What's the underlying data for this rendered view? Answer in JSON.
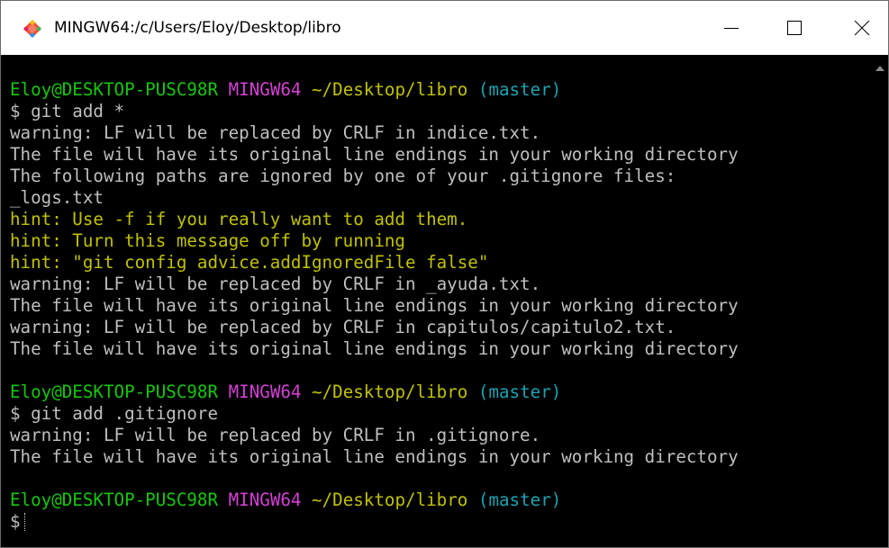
{
  "window": {
    "title": "MINGW64:/c/Users/Eloy/Desktop/libro",
    "icon": "git-icon"
  },
  "colors": {
    "user_host": "#16c60c",
    "mingw": "#d340d3",
    "path": "#c1c100",
    "branch": "#1aa3b3",
    "hint": "#c1c100",
    "text": "#bfbfbf",
    "background": "#000000"
  },
  "terminal": {
    "lines": [
      {
        "type": "prompt",
        "user_host": "Eloy@DESKTOP-PUSC98R",
        "env": "MINGW64",
        "path": "~/Desktop/libro",
        "branch": "(master)"
      },
      {
        "type": "text",
        "text": "$ git add *"
      },
      {
        "type": "text",
        "text": "warning: LF will be replaced by CRLF in indice.txt."
      },
      {
        "type": "text",
        "text": "The file will have its original line endings in your working directory"
      },
      {
        "type": "text",
        "text": "The following paths are ignored by one of your .gitignore files:"
      },
      {
        "type": "text",
        "text": "_logs.txt"
      },
      {
        "type": "hint",
        "text": "hint: Use -f if you really want to add them."
      },
      {
        "type": "hint",
        "text": "hint: Turn this message off by running"
      },
      {
        "type": "hint",
        "text": "hint: \"git config advice.addIgnoredFile false\""
      },
      {
        "type": "text",
        "text": "warning: LF will be replaced by CRLF in _ayuda.txt."
      },
      {
        "type": "text",
        "text": "The file will have its original line endings in your working directory"
      },
      {
        "type": "text",
        "text": "warning: LF will be replaced by CRLF in capitulos/capitulo2.txt."
      },
      {
        "type": "text",
        "text": "The file will have its original line endings in your working directory"
      },
      {
        "type": "text",
        "text": ""
      },
      {
        "type": "prompt",
        "user_host": "Eloy@DESKTOP-PUSC98R",
        "env": "MINGW64",
        "path": "~/Desktop/libro",
        "branch": "(master)"
      },
      {
        "type": "text",
        "text": "$ git add .gitignore"
      },
      {
        "type": "text",
        "text": "warning: LF will be replaced by CRLF in .gitignore."
      },
      {
        "type": "text",
        "text": "The file will have its original line endings in your working directory"
      },
      {
        "type": "text",
        "text": ""
      },
      {
        "type": "prompt",
        "user_host": "Eloy@DESKTOP-PUSC98R",
        "env": "MINGW64",
        "path": "~/Desktop/libro",
        "branch": "(master)"
      },
      {
        "type": "input",
        "text": "$"
      }
    ]
  }
}
